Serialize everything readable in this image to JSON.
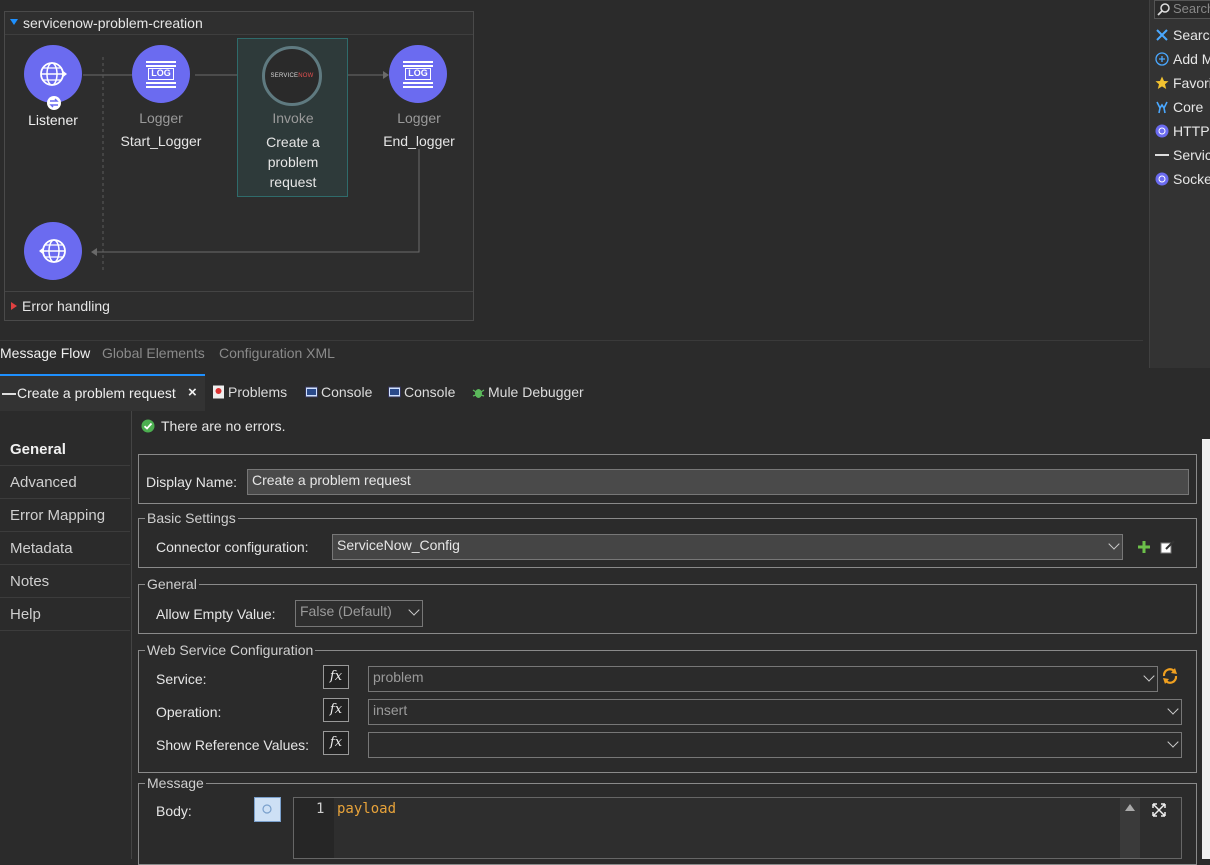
{
  "flow": {
    "title": "servicenow-problem-creation",
    "nodes": [
      {
        "type": "Listener",
        "name": ""
      },
      {
        "type": "Logger",
        "name": "Start_Logger"
      },
      {
        "type": "Invoke",
        "name": "Create a problem request"
      },
      {
        "type": "Logger",
        "name": "End_logger"
      }
    ],
    "error_handling": "Error handling",
    "log_text": "LOG",
    "servicenow_logo": {
      "service": "SERVICE",
      "now": "NOW"
    }
  },
  "editor_tabs": [
    "Message Flow",
    "Global Elements",
    "Configuration XML"
  ],
  "palette": {
    "search_placeholder": "Search",
    "items": [
      "Search",
      "Add M",
      "Favori",
      "Core",
      "HTTP",
      "Servic",
      "Socke"
    ]
  },
  "panel_tabs": {
    "active": "Create a problem request",
    "others": [
      "Problems",
      "Console",
      "Console",
      "Mule Debugger"
    ]
  },
  "properties": {
    "status": "There are no errors.",
    "nav": [
      "General",
      "Advanced",
      "Error Mapping",
      "Metadata",
      "Notes",
      "Help"
    ],
    "display_name_label": "Display Name:",
    "display_name_value": "Create a problem request",
    "basic_settings": {
      "legend": "Basic Settings",
      "connector_label": "Connector configuration:",
      "connector_value": "ServiceNow_Config"
    },
    "general": {
      "legend": "General",
      "allow_empty_label": "Allow Empty Value:",
      "allow_empty_value": "False (Default)"
    },
    "wsc": {
      "legend": "Web Service Configuration",
      "service_label": "Service:",
      "service_value": "problem",
      "operation_label": "Operation:",
      "operation_value": "insert",
      "show_ref_label": "Show Reference Values:",
      "show_ref_value": "",
      "fx": "fx"
    },
    "message": {
      "legend": "Message",
      "body_label": "Body:",
      "line_number": "1",
      "code": "payload"
    }
  },
  "colors": {
    "accent": "#1e90ff",
    "node_purple": "#6b6bf0",
    "code_orange": "#e8a33a",
    "ok_green": "#4caf50"
  }
}
